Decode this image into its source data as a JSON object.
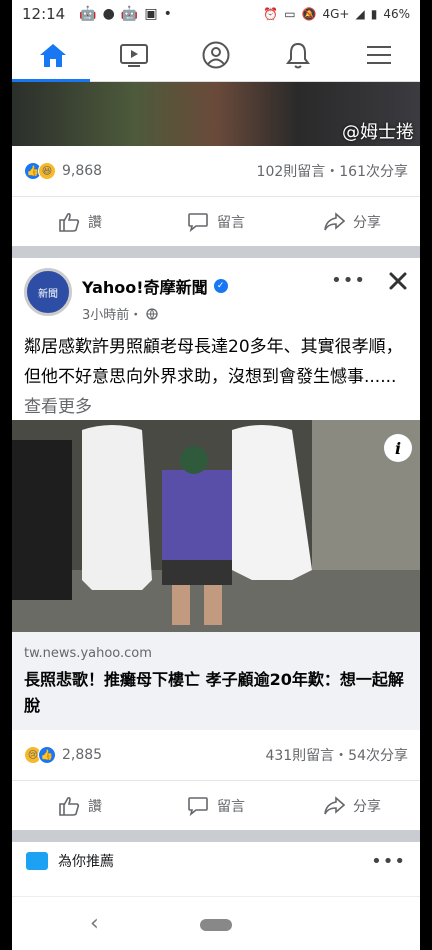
{
  "status_bar": {
    "time": "12:14",
    "network": "4G+",
    "battery": "46%"
  },
  "top_post": {
    "watermark": "@姆士捲",
    "reaction_count": "9,868",
    "stats": "102則留言・161次分享"
  },
  "actions": {
    "like": "讚",
    "comment": "留言",
    "share": "分享"
  },
  "post": {
    "page_name": "Yahoo!奇摩新聞",
    "avatar_label": "新聞",
    "timestamp": "3小時前・",
    "text": "鄰居感歎許男照顧老母長達20多年、其實很孝順，但他不好意思向外界求助，沒想到會發生憾事......",
    "see_more": "查看更多",
    "link_domain": "tw.news.yahoo.com",
    "link_title": "長照悲歌！推癱母下樓亡 孝子顧逾20年歎：想一起解脫",
    "reaction_count": "2,885",
    "stats": "431則留言・54次分享"
  },
  "recommend": {
    "label": "為你推薦"
  },
  "colors": {
    "accent": "#1877f2",
    "divider": "#c9ccd1"
  }
}
